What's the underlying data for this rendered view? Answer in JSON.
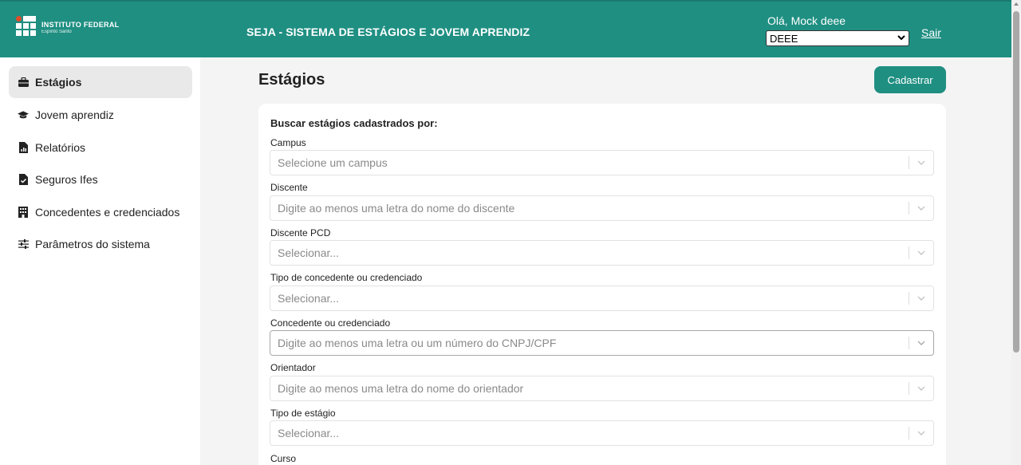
{
  "header": {
    "logo_line1": "INSTITUTO FEDERAL",
    "logo_line2": "Espírito Santo",
    "system_title": "SEJA - SISTEMA DE ESTÁGIOS E JOVEM APRENDIZ",
    "greeting": "Olá, Mock deee",
    "unit_selected": "DEEE",
    "logout_label": "Sair",
    "brand_color": "#1f8f82"
  },
  "sidebar": {
    "items": [
      {
        "label": "Estágios",
        "icon": "briefcase-icon",
        "active": true
      },
      {
        "label": "Jovem aprendiz",
        "icon": "graduation-cap-icon",
        "active": false
      },
      {
        "label": "Relatórios",
        "icon": "report-file-icon",
        "active": false
      },
      {
        "label": "Seguros Ifes",
        "icon": "file-check-icon",
        "active": false
      },
      {
        "label": "Concedentes e credenciados",
        "icon": "building-icon",
        "active": false
      },
      {
        "label": "Parâmetros do sistema",
        "icon": "sliders-icon",
        "active": false
      }
    ]
  },
  "main": {
    "page_title": "Estágios",
    "register_button": "Cadastrar",
    "search_heading": "Buscar estágios cadastrados por:",
    "filters": [
      {
        "label": "Campus",
        "placeholder": "Selecione um campus"
      },
      {
        "label": "Discente",
        "placeholder": "Digite ao menos uma letra do nome do discente"
      },
      {
        "label": "Discente PCD",
        "placeholder": "Selecionar..."
      },
      {
        "label": "Tipo de concedente ou credenciado",
        "placeholder": "Selecionar..."
      },
      {
        "label": "Concedente ou credenciado",
        "placeholder": "Digite ao menos uma letra ou um número do CNPJ/CPF"
      },
      {
        "label": "Orientador",
        "placeholder": "Digite ao menos uma letra do nome do orientador"
      },
      {
        "label": "Tipo de estágio",
        "placeholder": "Selecionar..."
      },
      {
        "label": "Curso",
        "placeholder": ""
      }
    ]
  }
}
